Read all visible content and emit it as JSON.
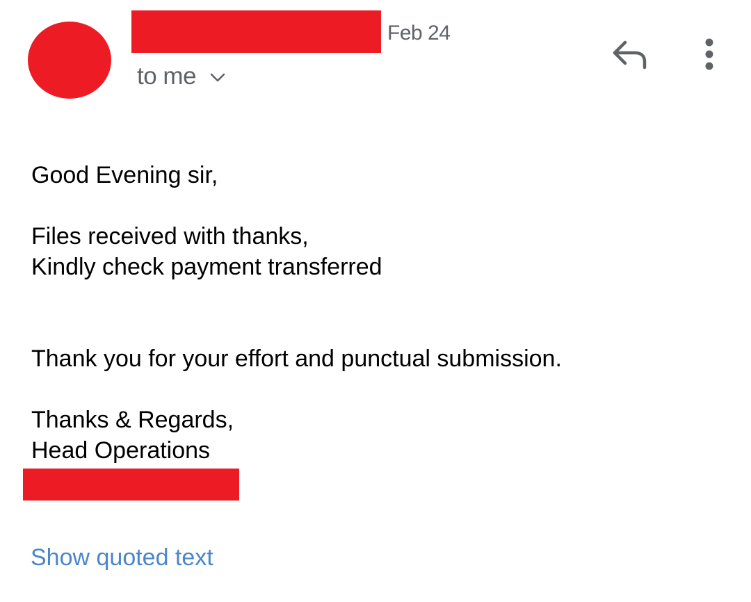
{
  "header": {
    "date": "Feb 24",
    "recipient_label": "to me",
    "icons": {
      "avatar": "avatar",
      "expand": "chevron-down-icon",
      "reply": "reply-icon",
      "more": "more-vert-icon"
    }
  },
  "message": {
    "greeting": "Good Evening sir,",
    "line_1": "Files received with thanks,",
    "line_2": "Kindly check payment transferred",
    "line_3": "Thank you for your effort and punctual submission.",
    "closing": "Thanks & Regards,",
    "signature_title": "Head Operations"
  },
  "footer": {
    "show_quoted_label": "Show quoted text"
  },
  "colors": {
    "redaction": "#ed1c24",
    "secondary_text": "#5f6368",
    "link": "#4a86c8",
    "body_text": "#000000"
  }
}
